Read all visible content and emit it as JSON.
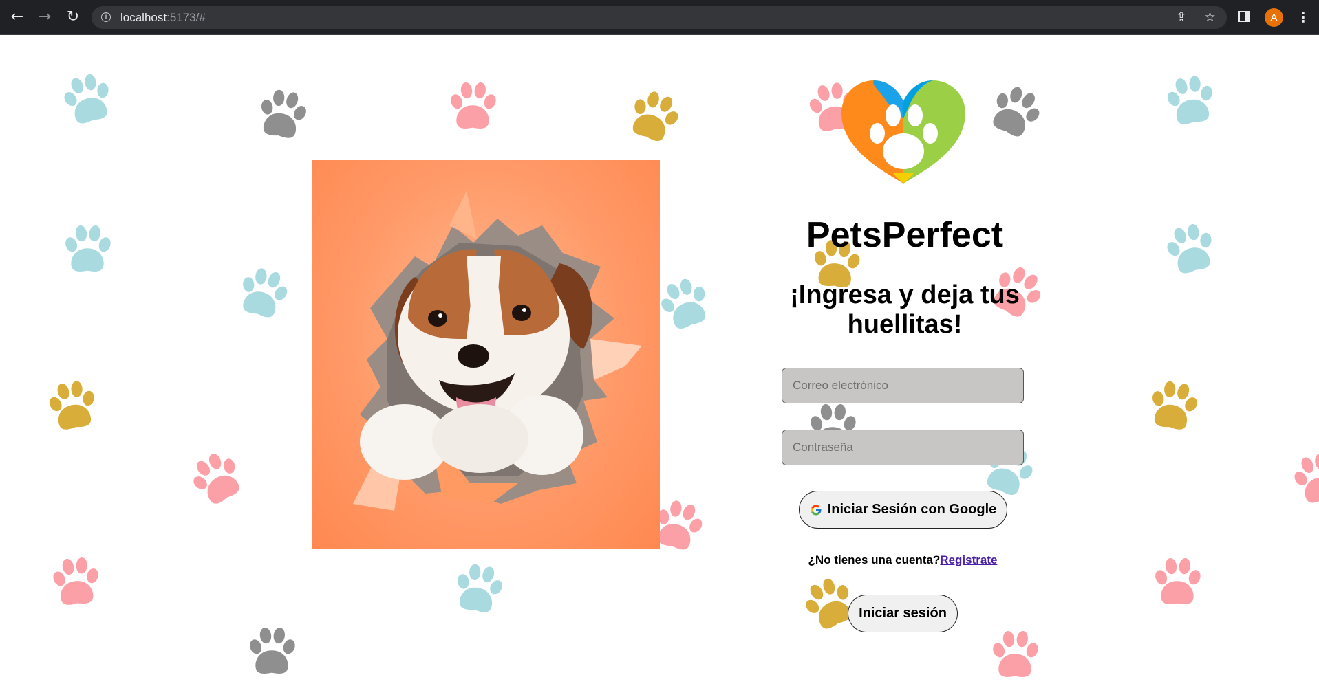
{
  "browser": {
    "back_icon": "arrow-left-icon",
    "forward_icon": "arrow-right-icon",
    "reload_icon": "reload-icon",
    "url_host": "localhost",
    "url_path": ":5173/#",
    "avatar_letter": "A"
  },
  "photo": {
    "alt": "Cachorro rompiendo papel naranja"
  },
  "brand": {
    "name": "PetsPerfect"
  },
  "login": {
    "subtitle": "¡Ingresa y deja tus huellitas!",
    "email_placeholder": "Correo electrónico",
    "password_placeholder": "Contraseña",
    "google_button": "Iniciar Sesión con Google",
    "no_account_text": "¿No tienes una cuenta?",
    "register_link": "Registrate",
    "submit_button": "Iniciar sesión"
  },
  "colors": {
    "paw_blue": "#a8dadf",
    "paw_gray": "#8f8f8f",
    "paw_pink": "#fca0a8",
    "paw_yellow": "#d8ad3a",
    "field_bg": "#c7c6c4",
    "button_bg": "#f0f0f0",
    "link": "#4b1eaa"
  }
}
